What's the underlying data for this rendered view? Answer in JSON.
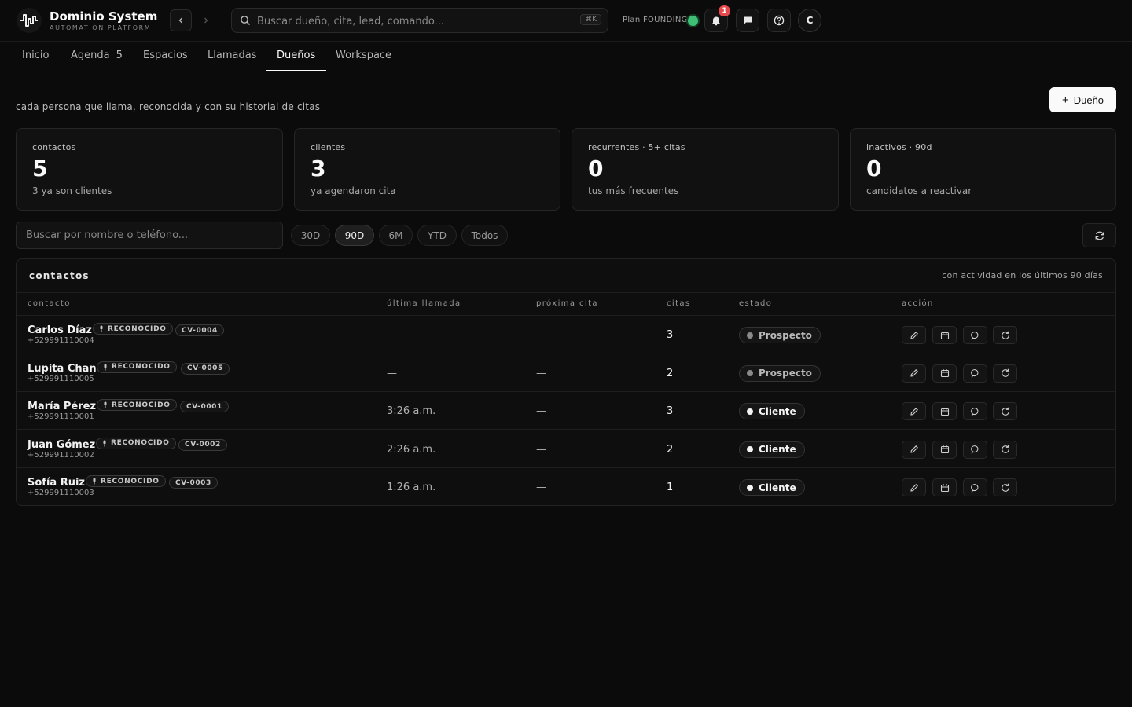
{
  "brand": {
    "title": "Dominio System",
    "subtitle": "AUTOMATION PLATFORM"
  },
  "header": {
    "search_placeholder": "Buscar dueño, cita, lead, comando...",
    "shortcut": "⌘K",
    "plan_label": "Plan FOUNDING",
    "notification_count": "1",
    "avatar_initial": "C"
  },
  "tabs": [
    {
      "label": "Inicio"
    },
    {
      "label": "Agenda",
      "count": "5"
    },
    {
      "label": "Espacios"
    },
    {
      "label": "Llamadas"
    },
    {
      "label": "Dueños",
      "active": true
    },
    {
      "label": "Workspace"
    }
  ],
  "page": {
    "subtitle": "cada persona que llama, reconocida y con su historial de citas",
    "add_button_label": "Dueño"
  },
  "stats": [
    {
      "label": "contactos",
      "value": "5",
      "desc": "3 ya son clientes"
    },
    {
      "label": "clientes",
      "value": "3",
      "desc": "ya agendaron cita"
    },
    {
      "label": "recurrentes · 5+ citas",
      "value": "0",
      "desc": "tus más frecuentes"
    },
    {
      "label": "inactivos · 90d",
      "value": "0",
      "desc": "candidatos a reactivar"
    }
  ],
  "filters": {
    "search_placeholder": "Buscar por nombre o teléfono...",
    "ranges": [
      "30D",
      "90D",
      "6M",
      "YTD",
      "Todos"
    ],
    "active_range": "90D"
  },
  "table": {
    "title": "contactos",
    "note": "con actividad en los últimos 90 días",
    "columns": [
      "contacto",
      "última llamada",
      "próxima cita",
      "citas",
      "estado",
      "acción"
    ],
    "recognized_label": "RECONOCIDO",
    "rows": [
      {
        "name": "Carlos Díaz",
        "phone": "+529991110004",
        "id": "CV-0004",
        "last_call": "—",
        "next_appt": "—",
        "citas": "3",
        "status": "Prospecto"
      },
      {
        "name": "Lupita Chan",
        "phone": "+529991110005",
        "id": "CV-0005",
        "last_call": "—",
        "next_appt": "—",
        "citas": "2",
        "status": "Prospecto"
      },
      {
        "name": "María Pérez",
        "phone": "+529991110001",
        "id": "CV-0001",
        "last_call": "3:26 a.m.",
        "next_appt": "—",
        "citas": "3",
        "status": "Cliente"
      },
      {
        "name": "Juan Gómez",
        "phone": "+529991110002",
        "id": "CV-0002",
        "last_call": "2:26 a.m.",
        "next_appt": "—",
        "citas": "2",
        "status": "Cliente"
      },
      {
        "name": "Sofía Ruiz",
        "phone": "+529991110003",
        "id": "CV-0003",
        "last_call": "1:26 a.m.",
        "next_appt": "—",
        "citas": "1",
        "status": "Cliente"
      }
    ]
  },
  "colors": {
    "background": "#0b0b0b",
    "surface": "#111111",
    "accent_green": "#3fbf75",
    "notification_red": "#e5484d"
  }
}
